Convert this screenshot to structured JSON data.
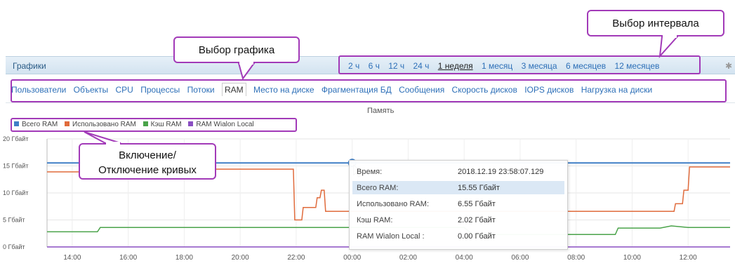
{
  "panel": {
    "title": "Графики",
    "intervals": [
      {
        "label": "2 ч",
        "active": false
      },
      {
        "label": "6 ч",
        "active": false
      },
      {
        "label": "12 ч",
        "active": false
      },
      {
        "label": "24 ч",
        "active": false
      },
      {
        "label": "1 неделя",
        "active": true
      },
      {
        "label": "1 месяц",
        "active": false
      },
      {
        "label": "3 месяца",
        "active": false
      },
      {
        "label": "6 месяцев",
        "active": false
      },
      {
        "label": "12 месяцев",
        "active": false
      }
    ]
  },
  "tabs": [
    {
      "label": "Пользователи",
      "active": false
    },
    {
      "label": "Объекты",
      "active": false
    },
    {
      "label": "CPU",
      "active": false
    },
    {
      "label": "Процессы",
      "active": false
    },
    {
      "label": "Потоки",
      "active": false
    },
    {
      "label": "RAM",
      "active": true
    },
    {
      "label": "Место на диске",
      "active": false
    },
    {
      "label": "Фрагментация БД",
      "active": false
    },
    {
      "label": "Сообщения",
      "active": false
    },
    {
      "label": "Скорость дисков",
      "active": false
    },
    {
      "label": "IOPS дисков",
      "active": false
    },
    {
      "label": "Нагрузка на диски",
      "active": false
    }
  ],
  "callouts": {
    "interval": "Выбор интервала",
    "graph": "Выбор графика",
    "toggle_line1": "Включение/",
    "toggle_line2": "Отключение кривых"
  },
  "chart_data": {
    "type": "line",
    "title": "Память",
    "ylim": [
      0,
      20
    ],
    "yticks": [
      "0 Гбайт",
      "5 Гбайт",
      "10 Гбайт",
      "15 Гбайт",
      "20 Гбайт"
    ],
    "xticks": [
      "14:00",
      "16:00",
      "18:00",
      "20:00",
      "22:00",
      "00:00",
      "02:00",
      "04:00",
      "06:00",
      "08:00",
      "10:00",
      "12:00"
    ],
    "x_hours": [
      13.1,
      37.5
    ],
    "grid": true,
    "series": [
      {
        "name": "Всего RAM",
        "color": "#3f7fc6",
        "points": [
          [
            13.1,
            15.55
          ],
          [
            37.5,
            15.55
          ]
        ]
      },
      {
        "name": "Использовано RAM",
        "color": "#e06b3c",
        "points": [
          [
            13.1,
            13.9
          ],
          [
            14.8,
            13.9
          ],
          [
            14.85,
            14.4
          ],
          [
            21.9,
            14.4
          ],
          [
            21.95,
            5.0
          ],
          [
            22.2,
            5.0
          ],
          [
            22.25,
            7.3
          ],
          [
            22.7,
            7.3
          ],
          [
            22.75,
            9.1
          ],
          [
            22.85,
            9.1
          ],
          [
            22.9,
            10.5
          ],
          [
            23.0,
            10.5
          ],
          [
            23.05,
            6.6
          ],
          [
            35.5,
            6.6
          ],
          [
            35.55,
            8.0
          ],
          [
            35.8,
            8.0
          ],
          [
            35.85,
            10.5
          ],
          [
            36.0,
            10.5
          ],
          [
            36.05,
            14.8
          ],
          [
            37.5,
            14.8
          ]
        ]
      },
      {
        "name": "Кэш RAM",
        "color": "#4aa34a",
        "points": [
          [
            13.1,
            2.8
          ],
          [
            14.9,
            2.8
          ],
          [
            15.0,
            3.6
          ],
          [
            28.0,
            3.6
          ],
          [
            28.3,
            2.3
          ],
          [
            33.4,
            2.3
          ],
          [
            33.5,
            3.5
          ],
          [
            35.0,
            3.5
          ],
          [
            35.4,
            3.9
          ],
          [
            36.0,
            3.6
          ],
          [
            37.5,
            3.6
          ]
        ]
      },
      {
        "name": "RAM Wialon Local",
        "color": "#8a4ec2",
        "points": [
          [
            13.1,
            0.0
          ],
          [
            37.5,
            0.0
          ]
        ]
      }
    ],
    "tooltip": {
      "rows": [
        {
          "label": "Время:",
          "value": "2018.12.19 23:58:07.129"
        },
        {
          "label": "Всего RAM:",
          "value": "15.55 Гбайт"
        },
        {
          "label": "Использовано RAM:",
          "value": "6.55 Гбайт"
        },
        {
          "label": "Кэш RAM:",
          "value": "2.02 Гбайт"
        },
        {
          "label": "RAM Wialon Local :",
          "value": "0.00 Гбайт"
        }
      ],
      "highlighted_row": 1
    },
    "cursor_hour": 24.0
  }
}
